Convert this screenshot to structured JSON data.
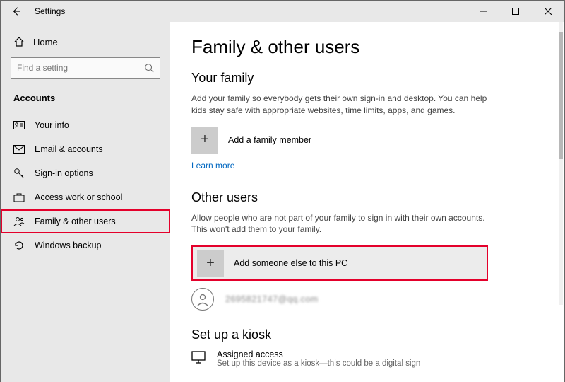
{
  "window": {
    "title": "Settings"
  },
  "sidebar": {
    "home": "Home",
    "search_placeholder": "Find a setting",
    "category": "Accounts",
    "items": [
      {
        "label": "Your info"
      },
      {
        "label": "Email & accounts"
      },
      {
        "label": "Sign-in options"
      },
      {
        "label": "Access work or school"
      },
      {
        "label": "Family & other users"
      },
      {
        "label": "Windows backup"
      }
    ]
  },
  "main": {
    "title": "Family & other users",
    "family": {
      "heading": "Your family",
      "desc": "Add your family so everybody gets their own sign-in and desktop. You can help kids stay safe with appropriate websites, time limits, apps, and games.",
      "add_label": "Add a family member",
      "learn_more": "Learn more"
    },
    "other": {
      "heading": "Other users",
      "desc": "Allow people who are not part of your family to sign in with their own accounts. This won't add them to your family.",
      "add_label": "Add someone else to this PC",
      "user_display": "2695821747@qq.com"
    },
    "kiosk": {
      "heading": "Set up a kiosk",
      "item_title": "Assigned access",
      "item_sub": "Set up this device as a kiosk—this could be a digital sign"
    }
  }
}
